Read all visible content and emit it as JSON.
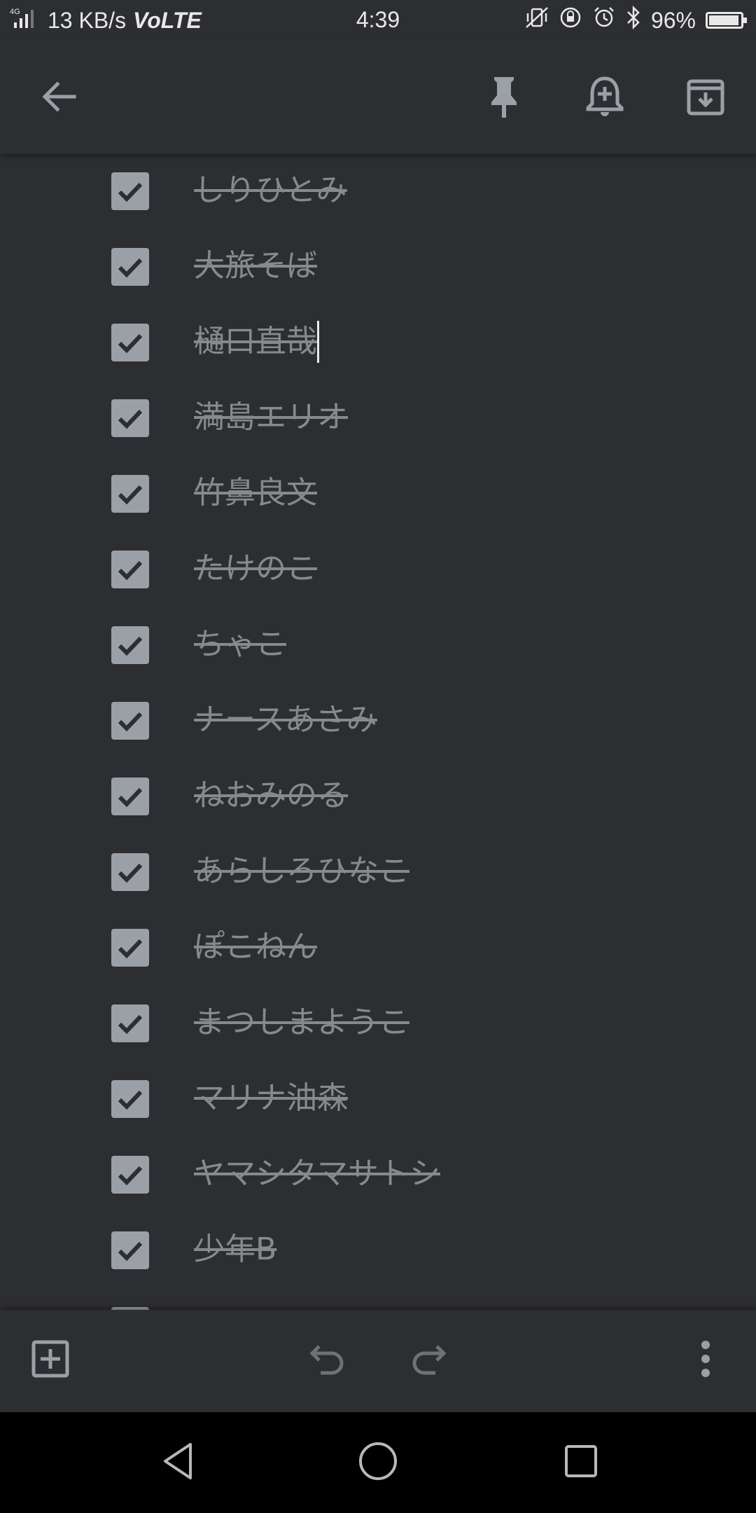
{
  "status_bar": {
    "network": "4G",
    "speed": "13 KB/s",
    "volte": "VoLTE",
    "time": "4:39",
    "battery": "96%",
    "battery_level": 0.96,
    "icons": [
      "signal-icon",
      "vibrate-icon",
      "rotation-lock-icon",
      "alarm-icon",
      "bluetooth-icon",
      "battery-icon"
    ]
  },
  "toolbar": {
    "back_icon": "arrow-back-icon",
    "pin_icon": "pin-icon",
    "reminder_icon": "add-reminder-icon",
    "archive_icon": "archive-icon"
  },
  "checklist": {
    "items": [
      {
        "text": "しりひとみ",
        "checked": true
      },
      {
        "text": "大旅そば",
        "checked": true
      },
      {
        "text": "樋口直哉",
        "checked": true,
        "focused": true
      },
      {
        "text": "満島エリオ",
        "checked": true
      },
      {
        "text": "竹鼻良文",
        "checked": true
      },
      {
        "text": "たけのこ",
        "checked": true
      },
      {
        "text": "ちゃこ",
        "checked": true
      },
      {
        "text": "ナースあさみ",
        "checked": true
      },
      {
        "text": "ねおみのる",
        "checked": true
      },
      {
        "text": "あらしろひなこ",
        "checked": true
      },
      {
        "text": "ぽこねん",
        "checked": true
      },
      {
        "text": "まつしまようこ",
        "checked": true
      },
      {
        "text": "マリナ油森",
        "checked": true
      },
      {
        "text": "ヤマシタマサトシ",
        "checked": true
      },
      {
        "text": "少年B",
        "checked": true
      }
    ]
  },
  "bottom_bar": {
    "add_icon": "add-box-icon",
    "undo_icon": "undo-icon",
    "redo_icon": "redo-icon",
    "more_icon": "more-vert-icon"
  },
  "nav_bar": {
    "back_icon": "nav-back-icon",
    "home_icon": "nav-home-icon",
    "recents_icon": "nav-recents-icon"
  },
  "colors": {
    "background": "#2d2e31",
    "checkbox": "#9aa0a6",
    "text_done": "#86898d",
    "icon": "#9aa0a6"
  }
}
